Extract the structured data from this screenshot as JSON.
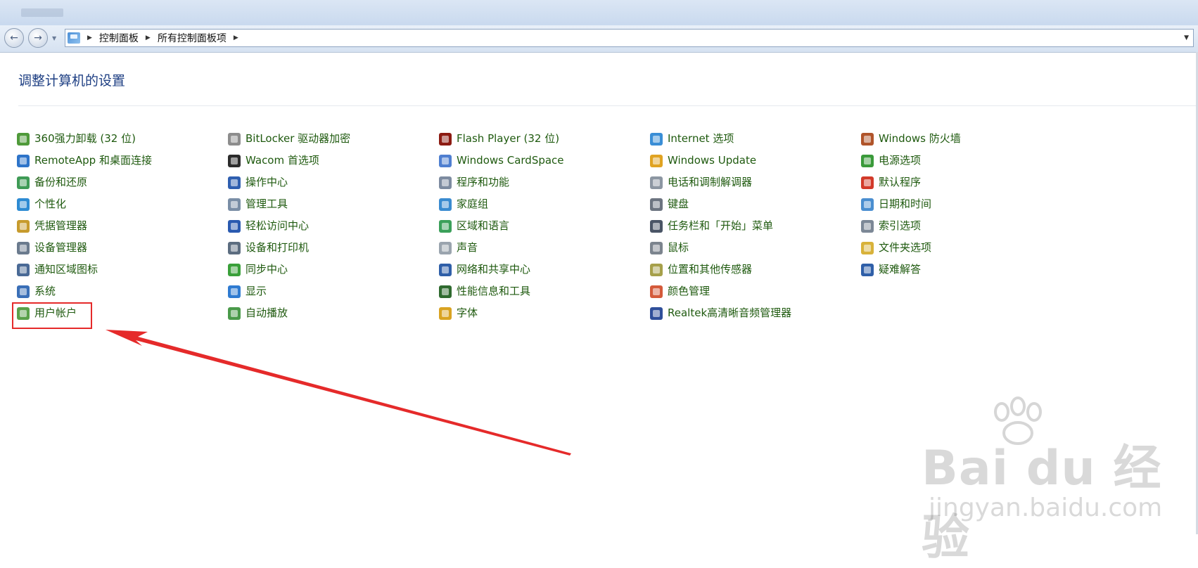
{
  "breadcrumb": {
    "items": [
      "控制面板",
      "所有控制面板项"
    ]
  },
  "page": {
    "title": "调整计算机的设置"
  },
  "items": [
    {
      "label": "360强力卸载 (32 位)",
      "icon": "uninstall-icon",
      "color": "#4f9a3a"
    },
    {
      "label": "RemoteApp 和桌面连接",
      "icon": "remote-desktop-icon",
      "color": "#2e74c9"
    },
    {
      "label": "备份和还原",
      "icon": "backup-icon",
      "color": "#3f9b56"
    },
    {
      "label": "个性化",
      "icon": "personalization-icon",
      "color": "#2d8bd3"
    },
    {
      "label": "凭据管理器",
      "icon": "credential-icon",
      "color": "#c79b2d"
    },
    {
      "label": "设备管理器",
      "icon": "device-manager-icon",
      "color": "#6b7b8e"
    },
    {
      "label": "通知区域图标",
      "icon": "notification-icon",
      "color": "#4a6a96"
    },
    {
      "label": "系统",
      "icon": "system-icon",
      "color": "#3a6fb7"
    },
    {
      "label": "用户帐户",
      "icon": "user-accounts-icon",
      "color": "#5aa14a"
    },
    {
      "label": "BitLocker 驱动器加密",
      "icon": "bitlocker-icon",
      "color": "#8d8d8d"
    },
    {
      "label": "Wacom 首选项",
      "icon": "wacom-icon",
      "color": "#2b2b2b"
    },
    {
      "label": "操作中心",
      "icon": "action-center-icon",
      "color": "#2f5fb0"
    },
    {
      "label": "管理工具",
      "icon": "admin-tools-icon",
      "color": "#7a8ea6"
    },
    {
      "label": "轻松访问中心",
      "icon": "ease-access-icon",
      "color": "#2a5ab0"
    },
    {
      "label": "设备和打印机",
      "icon": "printer-icon",
      "color": "#5c6d80"
    },
    {
      "label": "同步中心",
      "icon": "sync-icon",
      "color": "#3aa03a"
    },
    {
      "label": "显示",
      "icon": "display-icon",
      "color": "#2f7bd1"
    },
    {
      "label": "自动播放",
      "icon": "autoplay-icon",
      "color": "#4a9a4a"
    },
    {
      "label": "Flash Player (32 位)",
      "icon": "flash-icon",
      "color": "#8c1b12"
    },
    {
      "label": "Windows CardSpace",
      "icon": "cardspace-icon",
      "color": "#4f7fd0"
    },
    {
      "label": "程序和功能",
      "icon": "programs-icon",
      "color": "#7d8ba0"
    },
    {
      "label": "家庭组",
      "icon": "homegroup-icon",
      "color": "#3a8bd0"
    },
    {
      "label": "区域和语言",
      "icon": "region-icon",
      "color": "#3ba05a"
    },
    {
      "label": "声音",
      "icon": "sound-icon",
      "color": "#9aa4ae"
    },
    {
      "label": "网络和共享中心",
      "icon": "network-icon",
      "color": "#2f5fa8"
    },
    {
      "label": "性能信息和工具",
      "icon": "performance-icon",
      "color": "#2f6a2f"
    },
    {
      "label": "字体",
      "icon": "fonts-icon",
      "color": "#d9a322"
    },
    {
      "label": "Internet 选项",
      "icon": "internet-options-icon",
      "color": "#3a8ed6"
    },
    {
      "label": "Windows Update",
      "icon": "windows-update-icon",
      "color": "#e0a322"
    },
    {
      "label": "电话和调制解调器",
      "icon": "phone-modem-icon",
      "color": "#8c96a2"
    },
    {
      "label": "键盘",
      "icon": "keyboard-icon",
      "color": "#6c7480"
    },
    {
      "label": "任务栏和「开始」菜单",
      "icon": "taskbar-icon",
      "color": "#4a5566"
    },
    {
      "label": "鼠标",
      "icon": "mouse-icon",
      "color": "#7c848e"
    },
    {
      "label": "位置和其他传感器",
      "icon": "sensors-icon",
      "color": "#a6a04a"
    },
    {
      "label": "颜色管理",
      "icon": "color-management-icon",
      "color": "#d45a3a"
    },
    {
      "label": "Realtek高清晰音频管理器",
      "icon": "realtek-audio-icon",
      "color": "#2f4f9a"
    },
    {
      "label": "Windows 防火墙",
      "icon": "firewall-icon",
      "color": "#b0542a"
    },
    {
      "label": "电源选项",
      "icon": "power-icon",
      "color": "#3a9a3a"
    },
    {
      "label": "默认程序",
      "icon": "default-programs-icon",
      "color": "#d23a2a"
    },
    {
      "label": "日期和时间",
      "icon": "date-time-icon",
      "color": "#4a8ed0"
    },
    {
      "label": "索引选项",
      "icon": "indexing-icon",
      "color": "#7c8896"
    },
    {
      "label": "文件夹选项",
      "icon": "folder-options-icon",
      "color": "#d8b23a"
    },
    {
      "label": "疑难解答",
      "icon": "troubleshoot-icon",
      "color": "#2f5fa8"
    }
  ],
  "annotation": {
    "highlight_color": "#e52a2a"
  },
  "watermark": {
    "brand": "Bai du 经验",
    "url": "jingyan.baidu.com"
  }
}
